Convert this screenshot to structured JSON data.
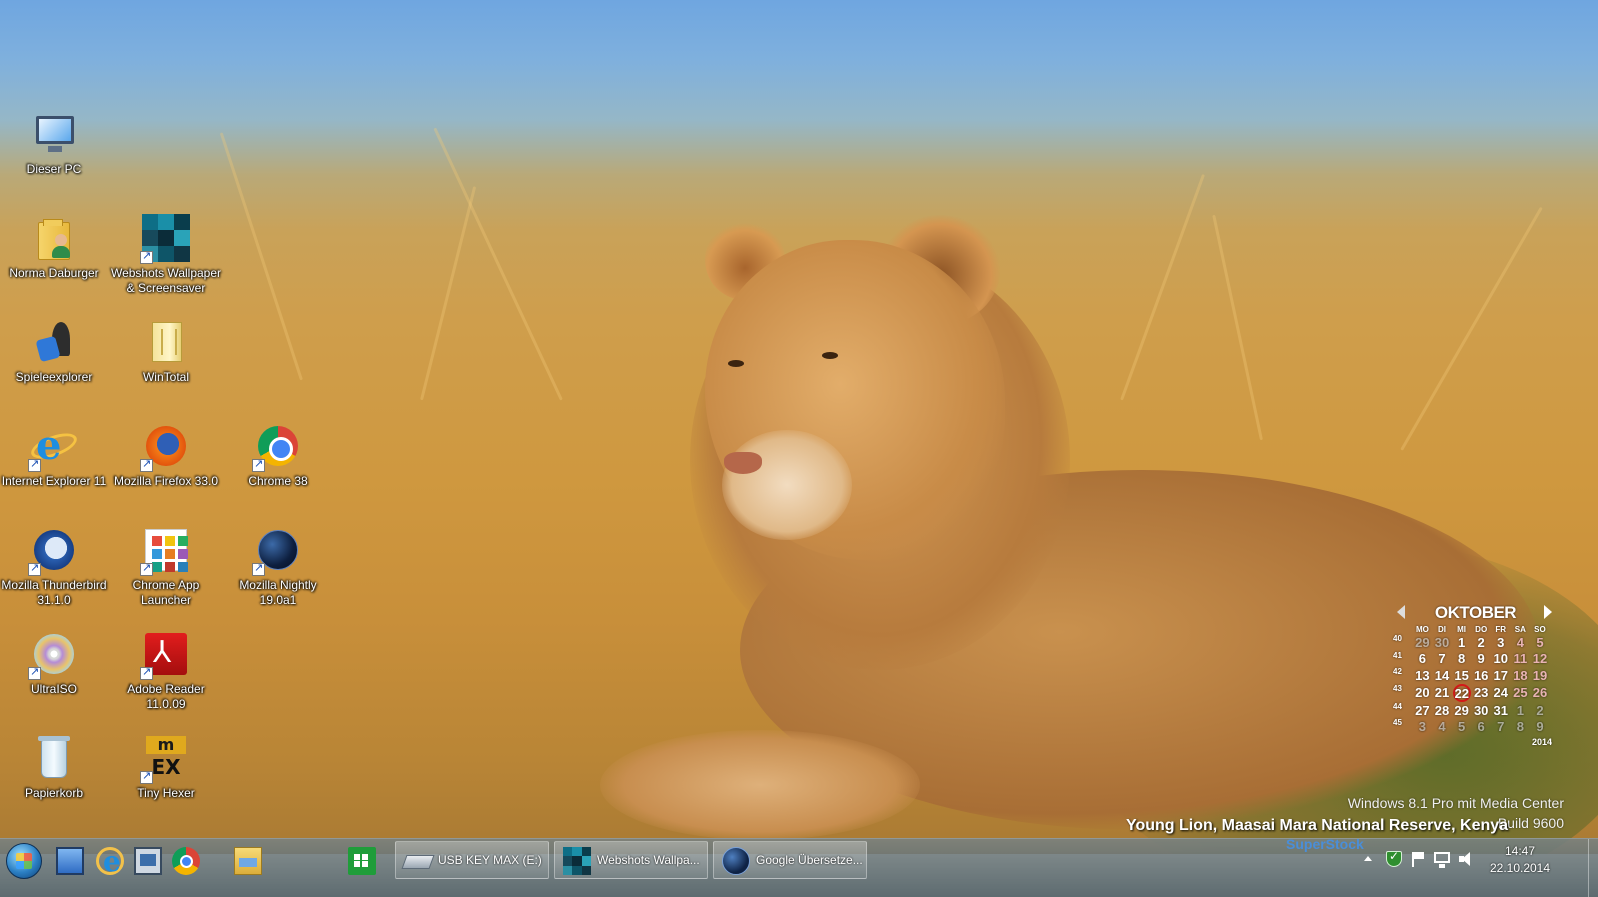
{
  "desktop": {
    "icons": [
      {
        "label": "Dieser PC",
        "icon": "computer-icon"
      },
      {
        "label": "Norma Daburger",
        "icon": "user-folder-icon"
      },
      {
        "label": "Webshots Wallpaper & Screensaver",
        "icon": "webshots-icon"
      },
      {
        "label": "Spieleexplorer",
        "icon": "games-explorer-icon"
      },
      {
        "label": "WinTotal",
        "icon": "wintotal-icon"
      },
      {
        "label": "Internet Explorer 11",
        "icon": "internet-explorer-icon"
      },
      {
        "label": "Mozilla Firefox 33.0",
        "icon": "firefox-icon"
      },
      {
        "label": "Chrome 38",
        "icon": "chrome-icon"
      },
      {
        "label": "Mozilla Thunderbird 31.1.0",
        "icon": "thunderbird-icon"
      },
      {
        "label": "Chrome App Launcher",
        "icon": "chrome-app-launcher-icon"
      },
      {
        "label": "Mozilla Nightly 19.0a1",
        "icon": "firefox-nightly-icon"
      },
      {
        "label": "UltraISO",
        "icon": "ultraiso-icon"
      },
      {
        "label": "Adobe Reader 11.0.09",
        "icon": "adobe-reader-icon"
      },
      {
        "label": "Papierkorb",
        "icon": "recycle-bin-icon"
      },
      {
        "label": "Tiny Hexer",
        "icon": "tiny-hexer-icon"
      }
    ],
    "caption": "Young Lion, Maasai Mara National Reserve, Kenya",
    "credit": "SuperStock",
    "watermark": {
      "edition": "Windows 8.1 Pro mit Media Center",
      "build": "Build 9600"
    }
  },
  "calendar": {
    "month": "OKTOBER",
    "year": "2014",
    "weekdays": [
      "MO",
      "DI",
      "MI",
      "DO",
      "FR",
      "SA",
      "SO"
    ],
    "weeks": [
      {
        "wk": "40",
        "days": [
          "29",
          "30",
          "1",
          "2",
          "3",
          "4",
          "5"
        ]
      },
      {
        "wk": "41",
        "days": [
          "6",
          "7",
          "8",
          "9",
          "10",
          "11",
          "12"
        ]
      },
      {
        "wk": "42",
        "days": [
          "13",
          "14",
          "15",
          "16",
          "17",
          "18",
          "19"
        ]
      },
      {
        "wk": "43",
        "days": [
          "20",
          "21",
          "22",
          "23",
          "24",
          "25",
          "26"
        ]
      },
      {
        "wk": "44",
        "days": [
          "27",
          "28",
          "29",
          "30",
          "31",
          "1",
          "2"
        ]
      },
      {
        "wk": "45",
        "days": [
          "3",
          "4",
          "5",
          "6",
          "7",
          "8",
          "9"
        ]
      }
    ],
    "today": "22"
  },
  "taskbar": {
    "pinned": [
      {
        "name": "desktop-icon"
      },
      {
        "name": "internet-explorer-icon"
      },
      {
        "name": "multi-screen-icon"
      },
      {
        "name": "chrome-icon"
      },
      {
        "name": "file-explorer-icon"
      },
      {
        "name": "windows-store-icon"
      }
    ],
    "tasks": [
      {
        "label": "USB KEY MAX (E:)",
        "icon": "usb-drive-icon"
      },
      {
        "label": "Webshots Wallpa...",
        "icon": "webshots-icon"
      },
      {
        "label": "Google Übersetze...",
        "icon": "globe-icon"
      }
    ],
    "clock": {
      "time": "14:47",
      "date": "22.10.2014"
    }
  },
  "colors": {
    "today_ring": "#d41919",
    "credit": "#4a8ed8",
    "store_green": "#1f9d3a"
  }
}
